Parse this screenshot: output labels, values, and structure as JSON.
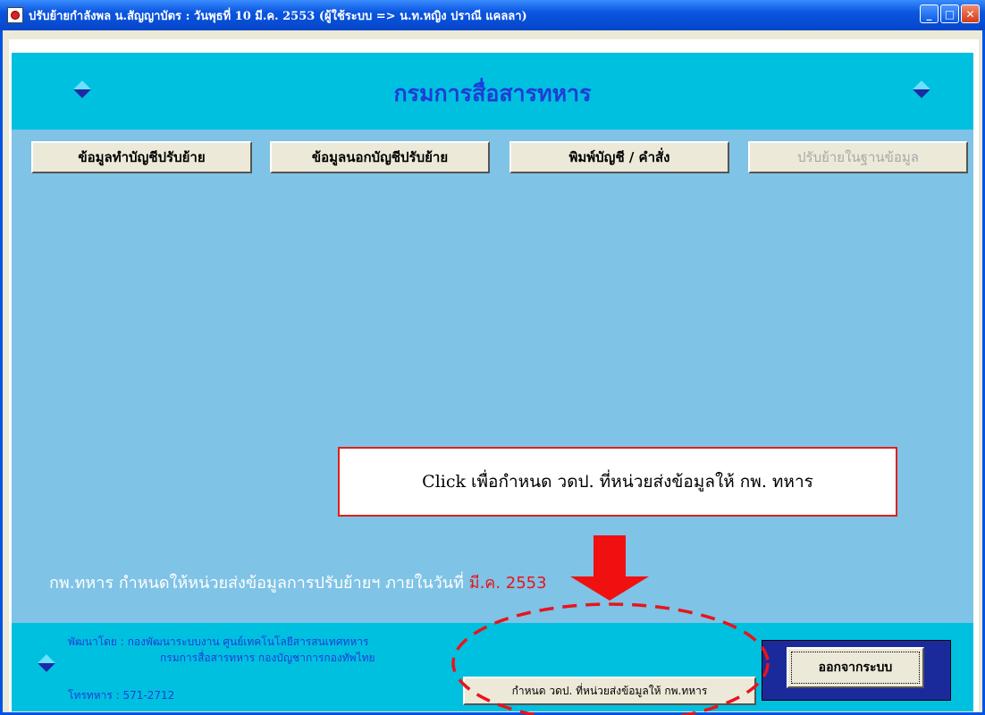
{
  "window": {
    "title": "ปรับย้ายกำลังพล น.สัญญาบัตร : วันพุธที่ 10 มี.ค. 2553    (ผู้ใช้ระบบ => น.ท.หญิง ปราณี แคลลา)",
    "controls": {
      "minimize": "_",
      "maximize": "□",
      "close": "✕"
    }
  },
  "header": {
    "title": "กรมการสื่อสารทหาร"
  },
  "toolbar": {
    "buttons": [
      {
        "label": "ข้อมูลทำบัญชีปรับย้าย",
        "enabled": true
      },
      {
        "label": "ข้อมูลนอกบัญชีปรับย้าย",
        "enabled": true
      },
      {
        "label": "พิมพ์บัญชี / คำสั่ง",
        "enabled": true
      },
      {
        "label": "ปรับย้ายในฐานข้อมูล",
        "enabled": false
      }
    ]
  },
  "callout": {
    "text": "Click  เพื่อกำหนด  วดป.  ที่หน่วยส่งข้อมูลให้  กพ. ทหาร"
  },
  "deadline": {
    "prefix": "กพ.ทหาร กำหนดให้หน่วยส่งข้อมูลการปรับย้ายฯ ภายในวันที่",
    "date": "มี.ค. 2553"
  },
  "footer": {
    "developer_line1": "พัฒนาโดย : กองพัฒนาระบบงาน ศูนย์เทคโนโลยีสารสนเทศทหาร",
    "developer_line2": "กรมการสื่อสารทหาร กองบัญชาการกองทัพไทย",
    "phone": "โทรทหาร : 571-2712",
    "set_date_button": "กำหนด วดป. ที่หน่วยส่งข้อมูลให้ กพ.ทหาร",
    "exit_button": "ออกจากระบบ"
  },
  "colors": {
    "header_bg": "#00c0e0",
    "main_bg": "#7fc3e6",
    "title_text": "#1f3cd6",
    "alert_red": "#e8141c"
  }
}
